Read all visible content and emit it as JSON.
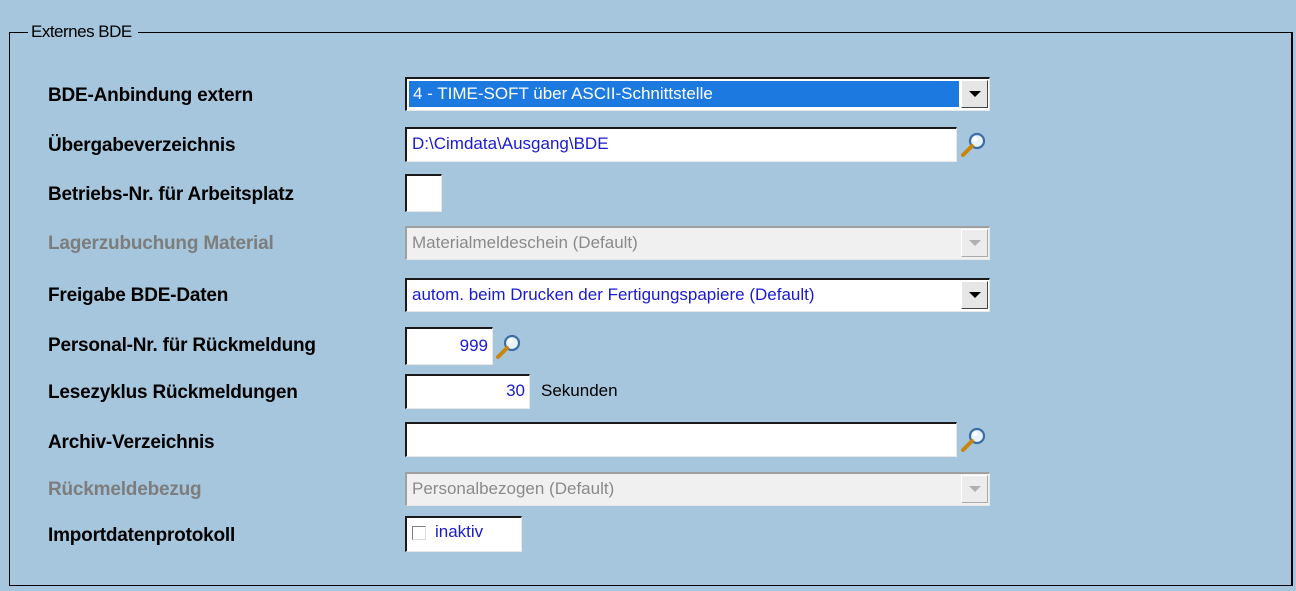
{
  "group_title": "Externes BDE",
  "rows": {
    "bde_anbindung": {
      "label": "BDE-Anbindung extern",
      "value": "4 - TIME-SOFT über ASCII-Schnittstelle"
    },
    "uebergabe": {
      "label": "Übergabeverzeichnis",
      "value": "D:\\Cimdata\\Ausgang\\BDE"
    },
    "betriebs_nr": {
      "label": "Betriebs-Nr. für Arbeitsplatz",
      "value": ""
    },
    "lagerzubuchung": {
      "label": "Lagerzubuchung Material",
      "value": "Materialmeldeschein (Default)"
    },
    "freigabe": {
      "label": "Freigabe BDE-Daten",
      "value": "autom. beim Drucken der Fertigungspapiere (Default)"
    },
    "personal_nr": {
      "label": "Personal-Nr. für Rückmeldung",
      "value": "999"
    },
    "lesezyklus": {
      "label": "Lesezyklus Rückmeldungen",
      "value": "30",
      "unit": "Sekunden"
    },
    "archiv": {
      "label": "Archiv-Verzeichnis",
      "value": ""
    },
    "rueckmeldebezug": {
      "label": "Rückmeldebezug",
      "value": "Personalbezogen (Default)"
    },
    "importprotokoll": {
      "label": "Importdatenprotokoll",
      "value": "inaktiv",
      "checked": false
    }
  },
  "colors": {
    "background": "#a5c6dc",
    "selection": "#1c79e0",
    "value_text": "#1a1ad0",
    "disabled_text": "#7d7d7d"
  },
  "icons": {
    "browse": "magnifier-icon",
    "dropdown": "chevron-down-icon"
  }
}
